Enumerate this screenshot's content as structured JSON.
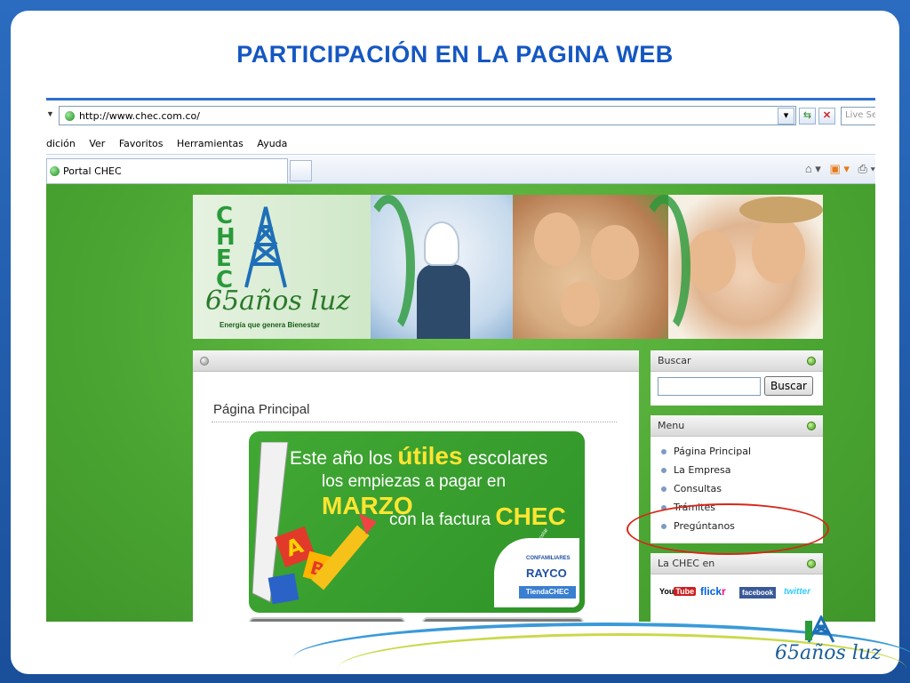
{
  "slide": {
    "title": "PARTICIPACIÓN EN LA PAGINA WEB",
    "corner_logo_text": "65años luz"
  },
  "browser": {
    "address": "http://www.chec.com.co/",
    "live_search_placeholder": "Live Sea",
    "menu": [
      "dición",
      "Ver",
      "Favoritos",
      "Herramientas",
      "Ayuda"
    ],
    "tab_title": "Portal CHEC",
    "icons": [
      "refresh-icon",
      "stop-icon",
      "home-icon",
      "feeds-icon",
      "print-icon"
    ]
  },
  "banner": {
    "logo_letters": "CHEC",
    "slogan": "65años luz",
    "tagline": "Energía que genera Bienestar"
  },
  "content": {
    "section_title": "Página Principal",
    "promo": {
      "line1_a": "Este año los ",
      "line1_b": "útiles",
      "line1_c": " escolares",
      "line2_a": "los empiezas a pagar en ",
      "line2_b": "MARZO",
      "line3_a": "con la factura ",
      "line3_b": "CHEC",
      "arc_text": "Útiles, Textos, Calzado Escolar",
      "brand1": "CONFAMILIARES",
      "brand2": "RAYCO",
      "brand3": "TiendaCHEC"
    }
  },
  "sidebar": {
    "search": {
      "title": "Buscar",
      "button": "Buscar",
      "value": ""
    },
    "menu": {
      "title": "Menu",
      "items": [
        "Página Principal",
        "La Empresa",
        "Consultas",
        "Trámites",
        "Pregúntanos"
      ]
    },
    "social": {
      "title": "La CHEC en",
      "youtube_a": "You",
      "youtube_b": "Tube",
      "flickr_a": "flick",
      "flickr_b": "r",
      "facebook": "facebook",
      "twitter": "twitter"
    }
  },
  "colors": {
    "title_blue": "#1557c2",
    "page_green": "#4aa532",
    "highlight_red": "#d5281a",
    "promo_yellow": "#ffe531"
  }
}
